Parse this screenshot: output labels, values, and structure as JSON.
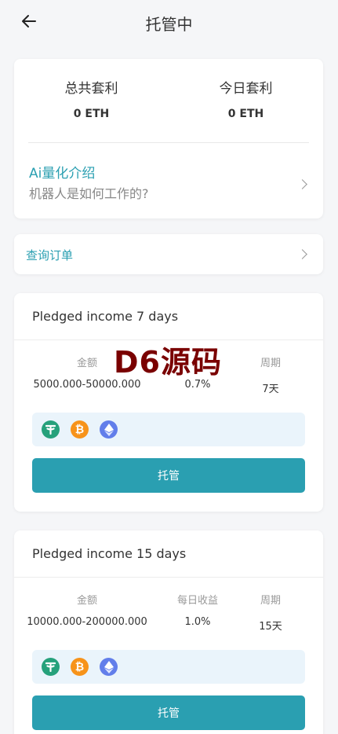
{
  "header": {
    "title": "托管中"
  },
  "stats": {
    "total_label": "总共套利",
    "total_value": "0 ETH",
    "today_label": "今日套利",
    "today_value": "0 ETH"
  },
  "intro": {
    "title": "Ai量化介绍",
    "subtitle": "机器人是如何工作的?"
  },
  "orders": {
    "label": "查询订单"
  },
  "watermark": "D6源码",
  "plans": [
    {
      "title": "Pledged income 7 days",
      "headers": [
        "金额",
        "",
        "周期"
      ],
      "amount": "5000.000-50000.000",
      "rate": "0.7%",
      "period": "7天",
      "coins": [
        "usdt-icon",
        "btc-icon",
        "eth-icon"
      ],
      "button": "托管"
    },
    {
      "title": "Pledged income 15 days",
      "headers": [
        "金额",
        "每日收益",
        "周期"
      ],
      "amount": "10000.000-200000.000",
      "rate": "1.0%",
      "period": "15天",
      "coins": [
        "usdt-icon",
        "btc-icon",
        "eth-icon"
      ],
      "button": "托管"
    }
  ],
  "colors": {
    "accent": "#2a9fb1",
    "usdt": "#26a17b",
    "btc": "#f7931a",
    "eth": "#627eea",
    "watermark": "#7a0000"
  }
}
